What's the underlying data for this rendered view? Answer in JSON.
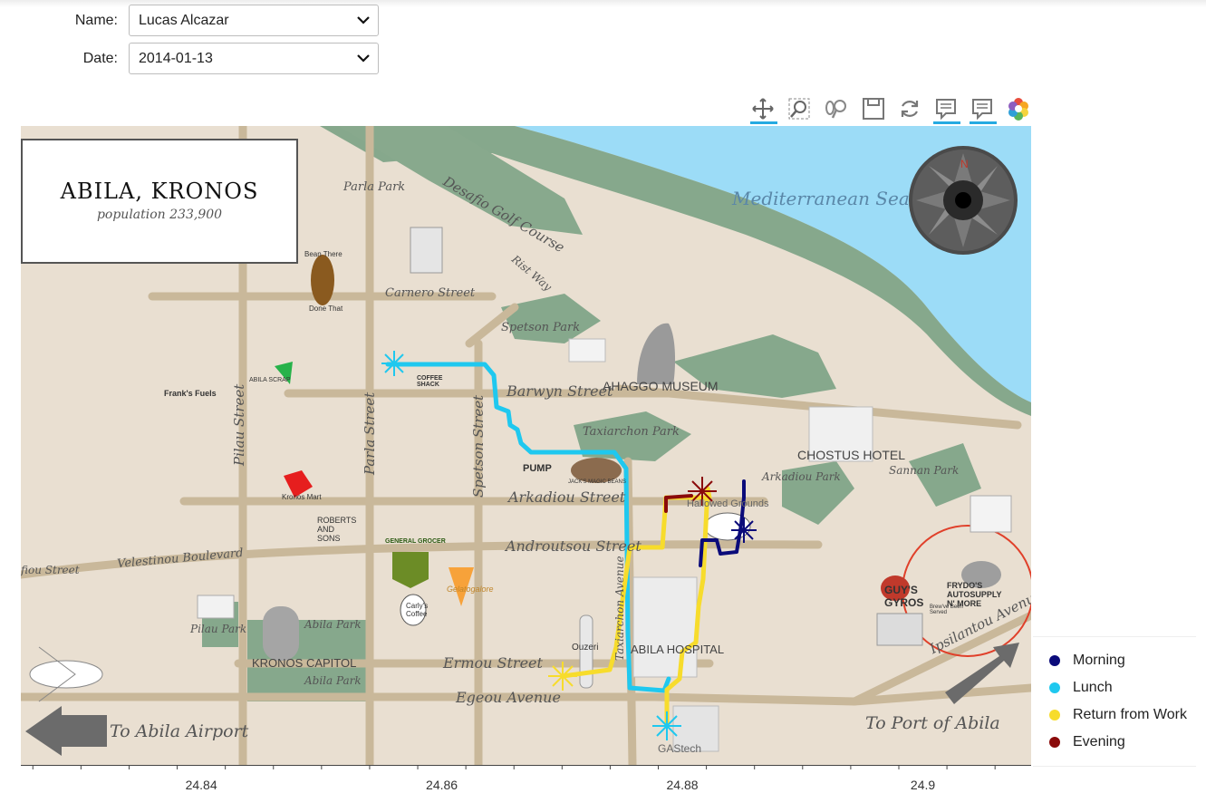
{
  "form": {
    "name_label": "Name:",
    "name_value": "Lucas Alcazar",
    "date_label": "Date:",
    "date_value": "2014-01-13"
  },
  "toolbar": {
    "tools": [
      "pan-icon",
      "box-zoom-icon",
      "wheel-zoom-icon",
      "save-icon",
      "reset-icon",
      "hover-tooltip-icon",
      "hover-tooltip-icon",
      "bokeh-logo-icon"
    ]
  },
  "map": {
    "title": "ABILA, KRONOS",
    "subtitle": "population 233,900",
    "labels": {
      "sea": "Mediterranean Sea",
      "golf": "Desafio Golf Course",
      "parla_park": "Parla Park",
      "carnero": "Carnero Street",
      "rist": "Rist Way",
      "spetson_park": "Spetson Park",
      "barwyn": "Barwyn Street",
      "museum": "AHAGGO MUSEUM",
      "taxiarchon_park": "Taxiarchon Park",
      "chostus": "CHOSTUS HOTEL",
      "arkadiou_park": "Arkadiou Park",
      "sannan_park": "Sannan Park",
      "arkadiou_st": "Arkadiou Street",
      "androutsou": "Androutsou Street",
      "velestinou": "Velestinou Boulevard",
      "fiou": "fiou Street",
      "pilau_st": "Pilau Street",
      "parla_st": "Parla Street",
      "spetson_st": "Spetson Street",
      "taxiarchon_ave": "Taxiarchon Avenue",
      "pilau_park": "Pilau Park",
      "abila_park1": "Abila Park",
      "abila_park2": "Abila Park",
      "capitol": "KRONOS CAPITOL",
      "ermou": "Ermou Street",
      "egeou": "Egeou Avenue",
      "hospital": "ABILA HOSPITAL",
      "ipsilantou": "Ipsilantou Avenue",
      "airport": "To Abila Airport",
      "port": "To Port of Abila",
      "bean_there": "Bean There",
      "done_that": "Done That",
      "franks": "Frank's Fuels",
      "abila_scrap": "ABILA SCRAP",
      "kronos_mart": "Kronos Mart",
      "roberts": "ROBERTS AND SONS",
      "general_grocer": "GENERAL GROCER",
      "carlys": "Carly's Coffee",
      "gelatogalore": "Gelatogalore",
      "ouzeri": "Ouzeri",
      "pump": "PUMP",
      "jacks": "JACK'S MAGIC BEANS",
      "hallowed": "Hallowed Grounds",
      "guys": "GUY'S GYROS",
      "frydos": "FRYDO'S AUTOSUPPLY N' MORE",
      "brew_served": "Brew've Been Served",
      "gastech": "GAStech",
      "coffee_shack": "COFFEE SHACK"
    }
  },
  "chart_data": {
    "type": "line",
    "xlabel": "",
    "ylabel": "",
    "xlim": [
      24.825,
      24.909
    ],
    "x_ticks": [
      "24.84",
      "24.86",
      "24.88",
      "24.9"
    ],
    "legend_position": "bottom-right",
    "series": [
      {
        "name": "Morning",
        "color": "#0b0b7a"
      },
      {
        "name": "Lunch",
        "color": "#1fc8ef"
      },
      {
        "name": "Return from Work",
        "color": "#f7dc2c"
      },
      {
        "name": "Evening",
        "color": "#8a0a0a"
      }
    ]
  },
  "legend": {
    "items": [
      {
        "label": "Morning",
        "color": "#0b0b7a"
      },
      {
        "label": "Lunch",
        "color": "#1fc8ef"
      },
      {
        "label": "Return from Work",
        "color": "#f7dc2c"
      },
      {
        "label": "Evening",
        "color": "#8a0a0a"
      }
    ]
  }
}
